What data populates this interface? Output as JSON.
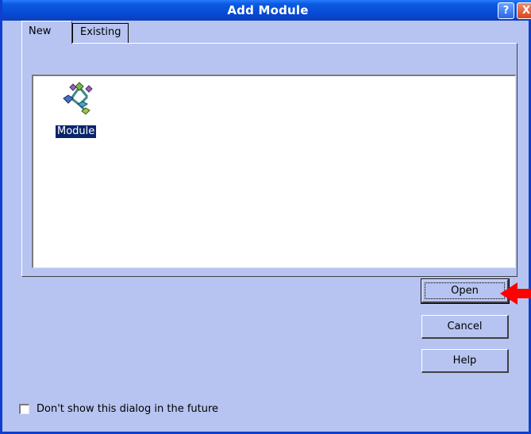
{
  "window": {
    "title": "Add Module",
    "help_glyph": "?",
    "close_glyph": "X"
  },
  "tabs": [
    {
      "label": "New",
      "selected": true
    },
    {
      "label": "Existing",
      "selected": false
    }
  ],
  "list": {
    "items": [
      {
        "label": "Module",
        "icon": "module-icon",
        "selected": true
      }
    ]
  },
  "buttons": {
    "open_label": "Open",
    "cancel_label": "Cancel",
    "help_label": "Help"
  },
  "footer": {
    "checkbox_label": "Don't show this dialog in the future",
    "checked": false
  },
  "colors": {
    "title_bar": "#0848d3",
    "dialog_bg": "#b7c4f1",
    "selection": "#0a246a",
    "annotation_arrow": "#ff0000"
  }
}
